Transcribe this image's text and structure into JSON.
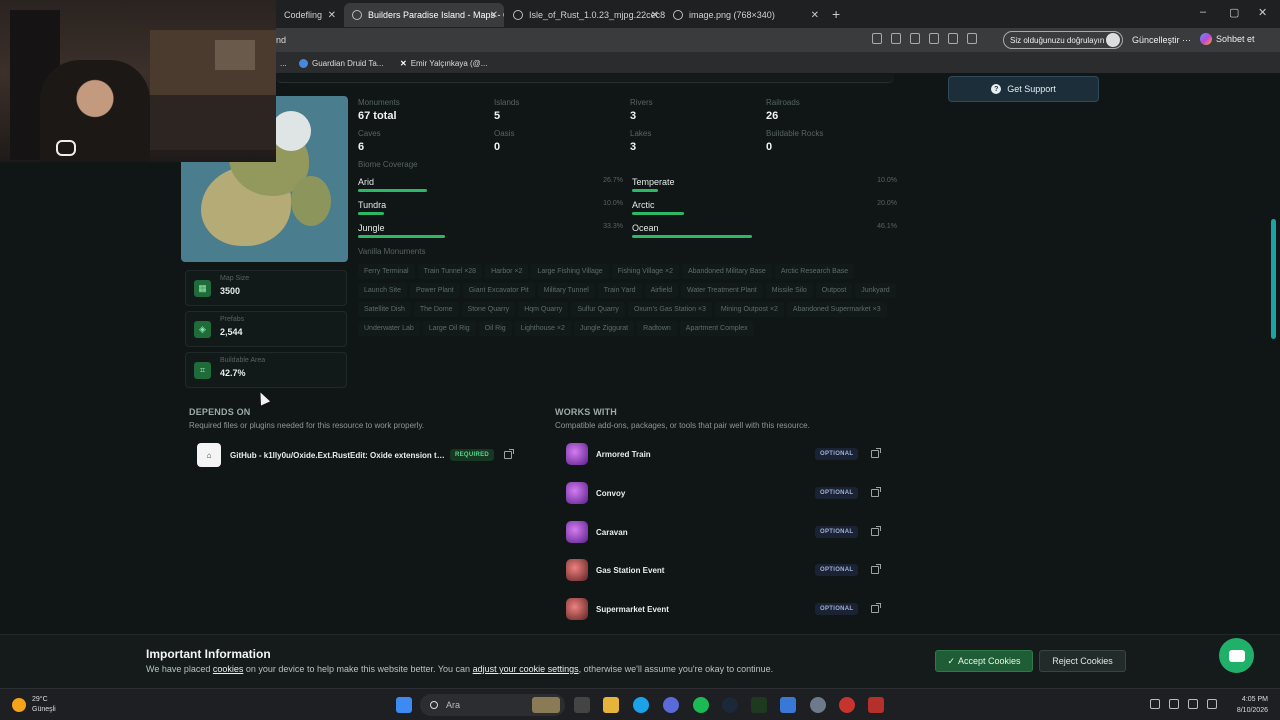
{
  "browser": {
    "tabs": [
      {
        "title": "Codefling"
      },
      {
        "title": "Builders Paradise Island - Maps - C"
      },
      {
        "title": "Isle_of_Rust_1.0.23_mjpg.22cec8"
      },
      {
        "title": "image.png (768×340)"
      }
    ],
    "address_fragment": "nd",
    "verify_pill": "Siz olduğunuzu doğrulayın",
    "update_label": "Güncelleştir",
    "update_dots": "···",
    "chat_label": "Sohbet et",
    "bookmarks": [
      "...",
      "Guardian Druid Ta...",
      "Emir Yalçınkaya (@..."
    ],
    "new_tab": "+",
    "minimize": "–",
    "maximize": "▢",
    "close": "✕"
  },
  "support_button": "Get Support",
  "stats": [
    {
      "label": "Monuments",
      "value": "67 total"
    },
    {
      "label": "Islands",
      "value": "5"
    },
    {
      "label": "Rivers",
      "value": "3"
    },
    {
      "label": "Railroads",
      "value": "26"
    },
    {
      "label": "Caves",
      "value": "6"
    },
    {
      "label": "Oasis",
      "value": "0"
    },
    {
      "label": "Lakes",
      "value": "3"
    },
    {
      "label": "Buildable Rocks",
      "value": "0"
    }
  ],
  "biome_title": "Biome Coverage",
  "biomes": [
    {
      "name": "Arid",
      "pct": "26.7%",
      "level": 26.7
    },
    {
      "name": "Temperate",
      "pct": "10.0%",
      "level": 10.0
    },
    {
      "name": "Tundra",
      "pct": "10.0%",
      "level": 10.0
    },
    {
      "name": "Arctic",
      "pct": "20.0%",
      "level": 20.0
    },
    {
      "name": "Jungle",
      "pct": "33.3%",
      "level": 33.3
    },
    {
      "name": "Ocean",
      "pct": "46.1%",
      "level": 46.1
    }
  ],
  "monuments_title": "Vanilla Monuments",
  "monuments": [
    "Ferry Terminal",
    "Train Tunnel ×28",
    "Harbor ×2",
    "Large Fishing Village",
    "Fishing Village ×2",
    "Abandoned Military Base",
    "Arctic Research Base",
    "Launch Site",
    "Power Plant",
    "Giant Excavator Pit",
    "Military Tunnel",
    "Train Yard",
    "Airfield",
    "Water Treatment Plant",
    "Missile Silo",
    "Outpost",
    "Junkyard",
    "Satellite Dish",
    "The Dome",
    "Stone Quarry",
    "Hqm Quarry",
    "Sulfur Quarry",
    "Oxum's Gas Station ×3",
    "Mining Outpost ×2",
    "Abandoned Supermarket ×3",
    "Underwater Lab",
    "Large Oil Rig",
    "Oil Rig",
    "Lighthouse ×2",
    "Jungle Ziggurat",
    "Radtown",
    "Apartment Complex"
  ],
  "tiles": [
    {
      "label": "Map Size",
      "value": "3500",
      "icon": "map-icon"
    },
    {
      "label": "Prefabs",
      "value": "2,544",
      "icon": "cube-icon"
    },
    {
      "label": "Buildable Area",
      "value": "42.7%",
      "icon": "area-icon"
    }
  ],
  "depends": {
    "title": "DEPENDS ON",
    "subtitle": "Required files or plugins needed for this resource to work properly.",
    "item": "GitHub - k1lly0u/Oxide.Ext.RustEdit: Oxide extension to ...",
    "badge": "REQUIRED"
  },
  "works": {
    "title": "WORKS WITH",
    "subtitle": "Compatible add-ons, packages, or tools that pair well with this resource.",
    "badge": "OPTIONAL",
    "items": [
      "Armored Train",
      "Convoy",
      "Caravan",
      "Gas Station Event",
      "Supermarket Event"
    ]
  },
  "cookie": {
    "title": "Important Information",
    "text_1": "We have placed ",
    "link_1": "cookies",
    "text_2": " on your device to help make this website better. You can ",
    "link_2": "adjust your cookie settings",
    "text_3": ", otherwise we'll assume you're okay to continue.",
    "accept": "Accept Cookies",
    "reject": "Reject Cookies"
  },
  "taskbar": {
    "temp": "29°C",
    "weather": "Güneşli",
    "search": "Ara",
    "time": "4:05 PM",
    "date": "8/10/2026"
  },
  "colors": {
    "accent_green": "#2db866",
    "support_blue": "#1b2e3a",
    "page_bg": "#101615"
  }
}
